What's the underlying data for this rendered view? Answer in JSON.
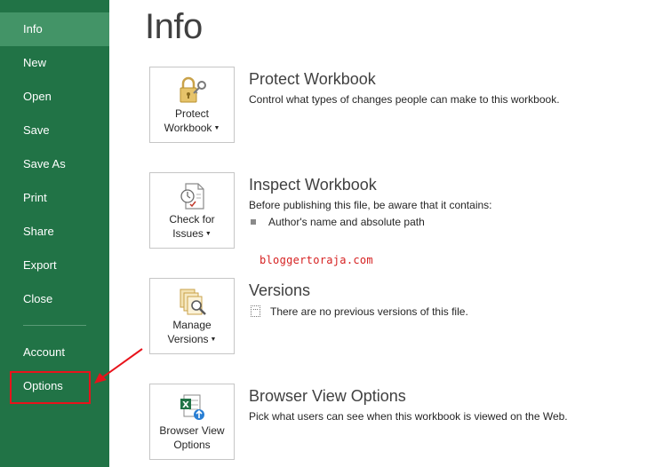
{
  "sidebar": {
    "items": [
      {
        "label": "Info"
      },
      {
        "label": "New"
      },
      {
        "label": "Open"
      },
      {
        "label": "Save"
      },
      {
        "label": "Save As"
      },
      {
        "label": "Print"
      },
      {
        "label": "Share"
      },
      {
        "label": "Export"
      },
      {
        "label": "Close"
      },
      {
        "label": "Account"
      },
      {
        "label": "Options"
      }
    ],
    "background": "#217346",
    "active_background": "#439467",
    "active_item": "Info"
  },
  "page": {
    "title": "Info"
  },
  "sections": {
    "protect": {
      "tile_line1": "Protect",
      "tile_line2": "Workbook",
      "title": "Protect Workbook",
      "description": "Control what types of changes people can make to this workbook.",
      "icon": "lock-key-icon"
    },
    "inspect": {
      "tile_line1": "Check for",
      "tile_line2": "Issues",
      "title": "Inspect Workbook",
      "description": "Before publishing this file, be aware that it contains:",
      "bullets": [
        "Author's name and absolute path"
      ],
      "icon": "checklist-icon"
    },
    "versions": {
      "tile_line1": "Manage",
      "tile_line2": "Versions",
      "title": "Versions",
      "description": "There are no previous versions of this file.",
      "icon": "manage-versions-icon"
    },
    "browser": {
      "tile_line1": "Browser View",
      "tile_line2": "Options",
      "title": "Browser View Options",
      "description": "Pick what users can see when this workbook is viewed on the Web.",
      "icon": "excel-web-icon"
    }
  },
  "watermark": "bloggertoraja.com",
  "annotation": {
    "highlight_color": "#e8131b",
    "highlighted_item": "Options"
  }
}
